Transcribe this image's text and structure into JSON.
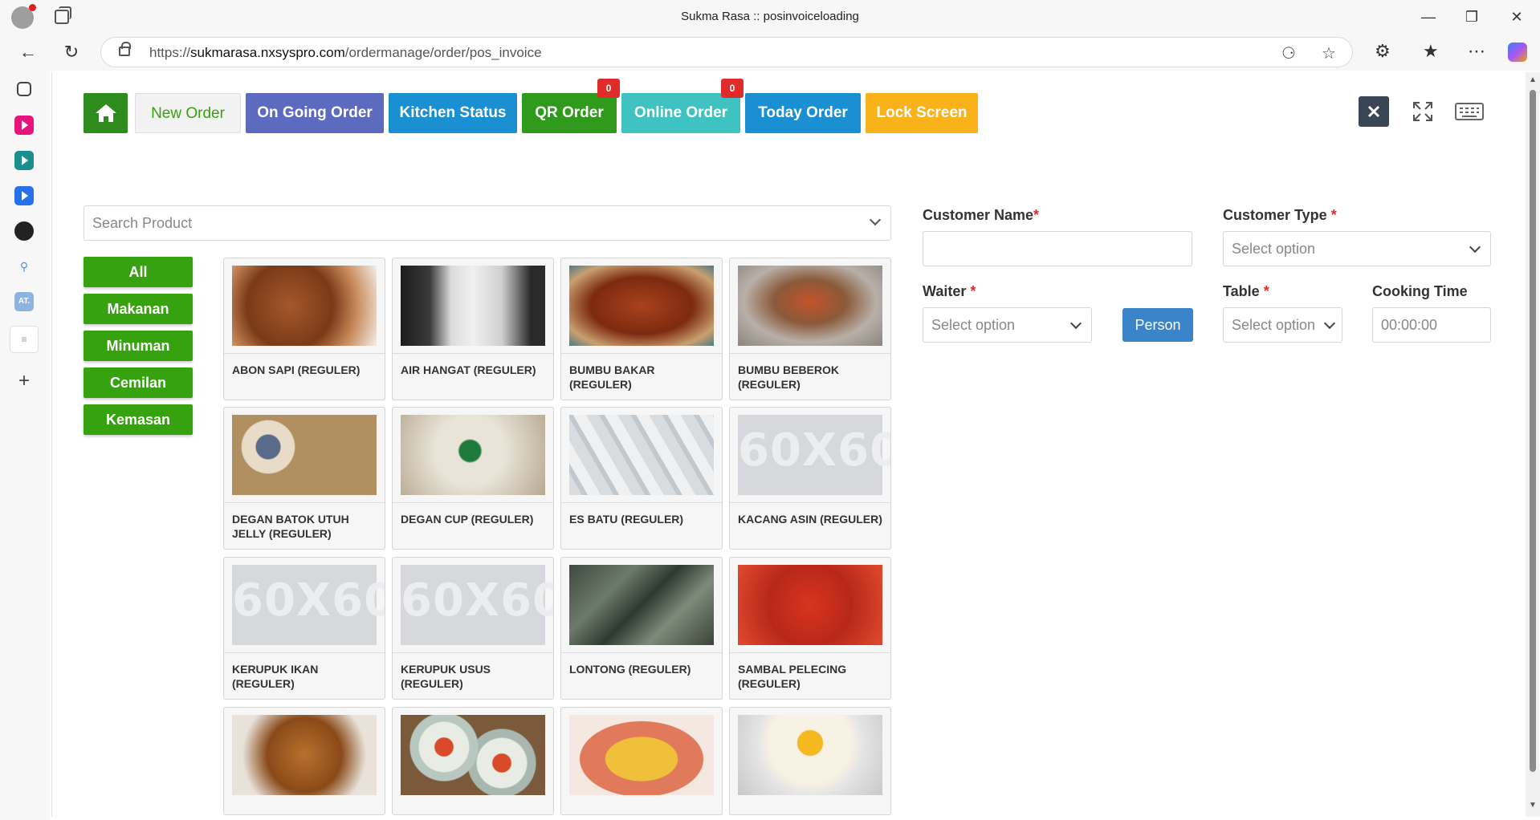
{
  "browser": {
    "window_title": "Sukma Rasa :: posinvoiceloading",
    "url_prefix": "https://",
    "url_host": "sukmarasa.nxsyspro.com",
    "url_path": "/ordermanage/order/pos_invoice"
  },
  "nav": {
    "new_order": "New Order",
    "on_going": "On Going Order",
    "kitchen": "Kitchen Status",
    "qr_order": "QR Order",
    "qr_badge": "0",
    "online_order": "Online Order",
    "online_badge": "0",
    "today_order": "Today Order",
    "lock_screen": "Lock Screen"
  },
  "search": {
    "placeholder": "Search Product"
  },
  "categories": [
    "All",
    "Makanan",
    "Minuman",
    "Cemilan",
    "Kemasan"
  ],
  "placeholder_image_text": "60X60",
  "products": [
    "ABON SAPI (REGULER)",
    "AIR HANGAT (REGULER)",
    "BUMBU BAKAR (REGULER)",
    "BUMBU BEBEROK (REGULER)",
    "DEGAN BATOK UTUH JELLY (REGULER)",
    "DEGAN CUP (REGULER)",
    "ES BATU (REGULER)",
    "KACANG ASIN (REGULER)",
    "KERUPUK IKAN (REGULER)",
    "KERUPUK USUS (REGULER)",
    "LONTONG (REGULER)",
    "SAMBAL PELECING (REGULER)"
  ],
  "form": {
    "customer_name_label": "Customer Name",
    "customer_type_label": "Customer Type",
    "customer_type_placeholder": "Select option",
    "waiter_label": "Waiter",
    "waiter_placeholder": "Select option",
    "person_button": "Person",
    "table_label": "Table",
    "table_placeholder": "Select option",
    "cooking_time_label": "Cooking Time",
    "cooking_time_placeholder": "00:00:00",
    "required_mark": "*"
  },
  "colors": {
    "home": "#2e8b1e",
    "new_order_text": "#37a20f",
    "on_going": "#5c6bc0",
    "kitchen": "#1a8fd1",
    "qr": "#2f9a1c",
    "online": "#3fc2c2",
    "today": "#1a8fd1",
    "lock": "#f9b21a",
    "category": "#37a20f",
    "person": "#3a84c9"
  }
}
